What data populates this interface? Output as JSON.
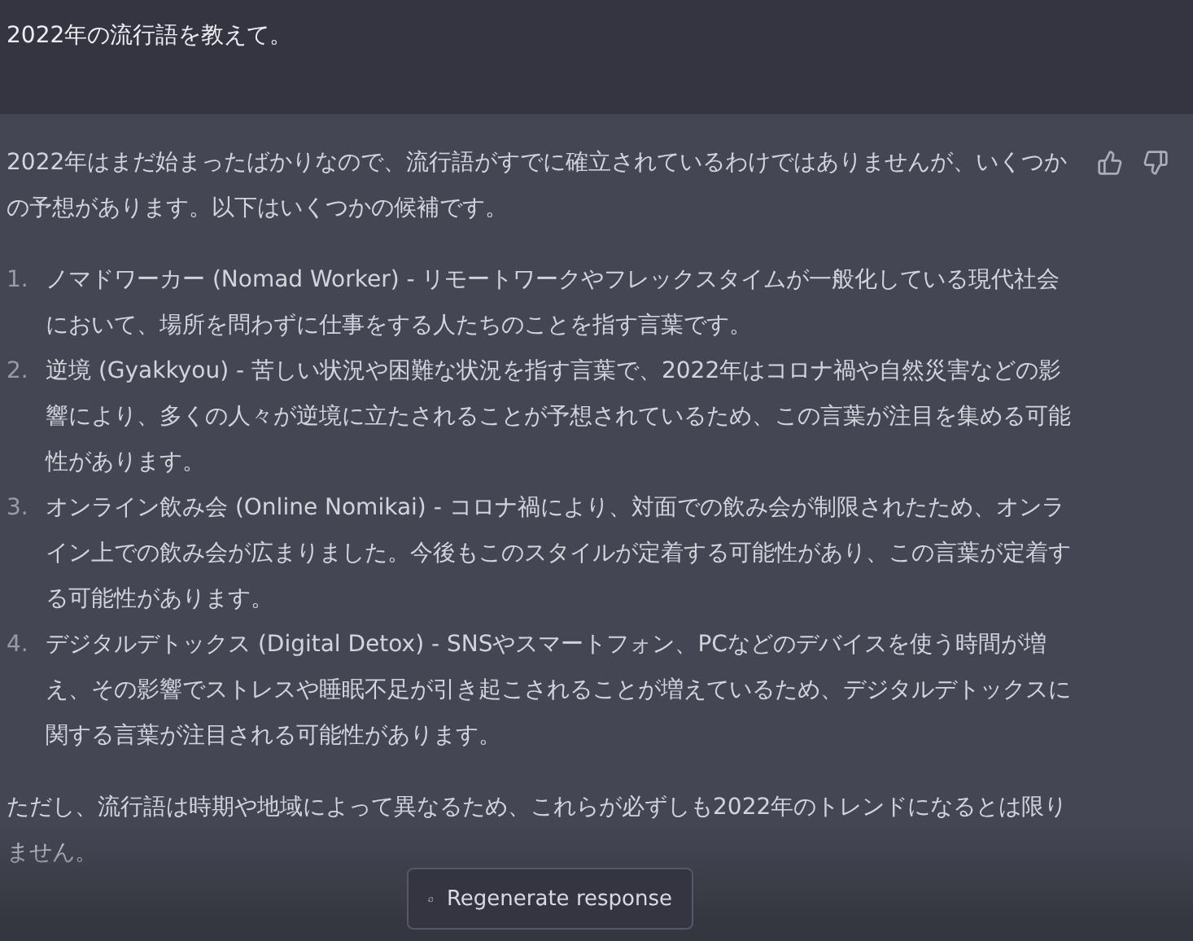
{
  "user_message": {
    "text": "2022年の流行語を教えて。"
  },
  "response": {
    "intro": "2022年はまだ始まったばかりなので、流行語がすでに確立されているわけではありませんが、いくつかの予想があります。以下はいくつかの候補です。",
    "items": [
      {
        "number": "1.",
        "text": "ノマドワーカー (Nomad Worker) - リモートワークやフレックスタイムが一般化している現代社会において、場所を問わずに仕事をする人たちのことを指す言葉です。"
      },
      {
        "number": "2.",
        "text": "逆境 (Gyakkyou) - 苦しい状況や困難な状況を指す言葉で、2022年はコロナ禍や自然災害などの影響により、多くの人々が逆境に立たされることが予想されているため、この言葉が注目を集める可能性があります。"
      },
      {
        "number": "3.",
        "text": "オンライン飲み会 (Online Nomikai) - コロナ禍により、対面での飲み会が制限されたため、オンライン上での飲み会が広まりました。今後もこのスタイルが定着する可能性があり、この言葉が定着する可能性があります。"
      },
      {
        "number": "4.",
        "text": "デジタルデトックス (Digital Detox) - SNSやスマートフォン、PCなどのデバイスを使う時間が増え、その影響でストレスや睡眠不足が引き起こされることが増えているため、デジタルデトックスに関する言葉が注目される可能性があります。"
      }
    ],
    "closing": "ただし、流行語は時期や地域によって異なるため、これらが必ずしも2022年のトレンドになるとは限りません。"
  },
  "regenerate_button": {
    "label": "Regenerate response"
  }
}
